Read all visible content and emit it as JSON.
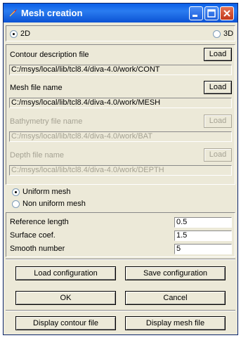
{
  "window": {
    "title": "Mesh creation",
    "app_icon": "tk-feather-icon"
  },
  "titlebar_buttons": [
    "minimize-icon",
    "maximize-icon",
    "close-icon"
  ],
  "dimension": {
    "options": [
      "2D",
      "3D"
    ],
    "selected": "2D"
  },
  "contour": {
    "label": "Contour description file",
    "load_label": "Load",
    "path": "C:/msys/local/lib/tcl8.4/diva-4.0/work/CONT",
    "enabled": true
  },
  "mesh_file": {
    "label": "Mesh file name",
    "load_label": "Load",
    "path": "C:/msys/local/lib/tcl8.4/diva-4.0/work/MESH",
    "enabled": true
  },
  "bathymetry": {
    "label": "Bathymetry file name",
    "load_label": "Load",
    "path": "C:/msys/local/lib/tcl8.4/diva-4.0/work/BAT",
    "enabled": false
  },
  "depth": {
    "label": "Depth file name",
    "load_label": "Load",
    "path": "C:/msys/local/lib/tcl8.4/diva-4.0/work/DEPTH",
    "enabled": false
  },
  "mesh_type": {
    "options": [
      "Uniform mesh",
      "Non uniform mesh"
    ],
    "selected": "Uniform mesh"
  },
  "params": {
    "reference_length": {
      "label": "Reference length",
      "value": "0.5"
    },
    "surface_coef": {
      "label": "Surface coef.",
      "value": "1.5"
    },
    "smooth_number": {
      "label": "Smooth number",
      "value": "5"
    }
  },
  "buttons": {
    "load_config": "Load configuration",
    "save_config": "Save configuration",
    "ok": "OK",
    "cancel": "Cancel",
    "display_contour": "Display contour file",
    "display_mesh": "Display mesh file"
  },
  "colors": {
    "title_bar": "#0a5ee8",
    "window_face": "#ece9d8",
    "disabled_text": "#a5a293"
  }
}
